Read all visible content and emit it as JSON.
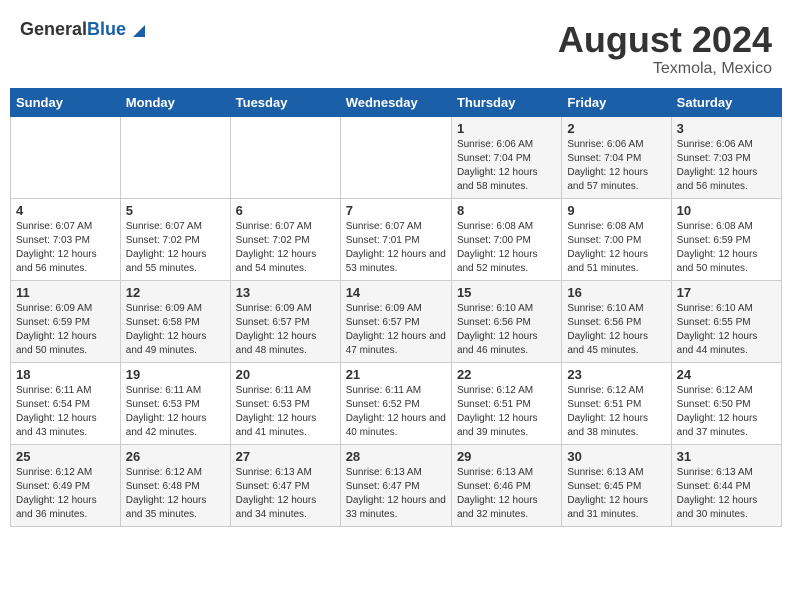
{
  "header": {
    "logo_general": "General",
    "logo_blue": "Blue",
    "month_year": "August 2024",
    "location": "Texmola, Mexico"
  },
  "weekdays": [
    "Sunday",
    "Monday",
    "Tuesday",
    "Wednesday",
    "Thursday",
    "Friday",
    "Saturday"
  ],
  "weeks": [
    [
      {
        "day": "",
        "sunrise": "",
        "sunset": "",
        "daylight": ""
      },
      {
        "day": "",
        "sunrise": "",
        "sunset": "",
        "daylight": ""
      },
      {
        "day": "",
        "sunrise": "",
        "sunset": "",
        "daylight": ""
      },
      {
        "day": "",
        "sunrise": "",
        "sunset": "",
        "daylight": ""
      },
      {
        "day": "1",
        "sunrise": "Sunrise: 6:06 AM",
        "sunset": "Sunset: 7:04 PM",
        "daylight": "Daylight: 12 hours and 58 minutes."
      },
      {
        "day": "2",
        "sunrise": "Sunrise: 6:06 AM",
        "sunset": "Sunset: 7:04 PM",
        "daylight": "Daylight: 12 hours and 57 minutes."
      },
      {
        "day": "3",
        "sunrise": "Sunrise: 6:06 AM",
        "sunset": "Sunset: 7:03 PM",
        "daylight": "Daylight: 12 hours and 56 minutes."
      }
    ],
    [
      {
        "day": "4",
        "sunrise": "Sunrise: 6:07 AM",
        "sunset": "Sunset: 7:03 PM",
        "daylight": "Daylight: 12 hours and 56 minutes."
      },
      {
        "day": "5",
        "sunrise": "Sunrise: 6:07 AM",
        "sunset": "Sunset: 7:02 PM",
        "daylight": "Daylight: 12 hours and 55 minutes."
      },
      {
        "day": "6",
        "sunrise": "Sunrise: 6:07 AM",
        "sunset": "Sunset: 7:02 PM",
        "daylight": "Daylight: 12 hours and 54 minutes."
      },
      {
        "day": "7",
        "sunrise": "Sunrise: 6:07 AM",
        "sunset": "Sunset: 7:01 PM",
        "daylight": "Daylight: 12 hours and 53 minutes."
      },
      {
        "day": "8",
        "sunrise": "Sunrise: 6:08 AM",
        "sunset": "Sunset: 7:00 PM",
        "daylight": "Daylight: 12 hours and 52 minutes."
      },
      {
        "day": "9",
        "sunrise": "Sunrise: 6:08 AM",
        "sunset": "Sunset: 7:00 PM",
        "daylight": "Daylight: 12 hours and 51 minutes."
      },
      {
        "day": "10",
        "sunrise": "Sunrise: 6:08 AM",
        "sunset": "Sunset: 6:59 PM",
        "daylight": "Daylight: 12 hours and 50 minutes."
      }
    ],
    [
      {
        "day": "11",
        "sunrise": "Sunrise: 6:09 AM",
        "sunset": "Sunset: 6:59 PM",
        "daylight": "Daylight: 12 hours and 50 minutes."
      },
      {
        "day": "12",
        "sunrise": "Sunrise: 6:09 AM",
        "sunset": "Sunset: 6:58 PM",
        "daylight": "Daylight: 12 hours and 49 minutes."
      },
      {
        "day": "13",
        "sunrise": "Sunrise: 6:09 AM",
        "sunset": "Sunset: 6:57 PM",
        "daylight": "Daylight: 12 hours and 48 minutes."
      },
      {
        "day": "14",
        "sunrise": "Sunrise: 6:09 AM",
        "sunset": "Sunset: 6:57 PM",
        "daylight": "Daylight: 12 hours and 47 minutes."
      },
      {
        "day": "15",
        "sunrise": "Sunrise: 6:10 AM",
        "sunset": "Sunset: 6:56 PM",
        "daylight": "Daylight: 12 hours and 46 minutes."
      },
      {
        "day": "16",
        "sunrise": "Sunrise: 6:10 AM",
        "sunset": "Sunset: 6:56 PM",
        "daylight": "Daylight: 12 hours and 45 minutes."
      },
      {
        "day": "17",
        "sunrise": "Sunrise: 6:10 AM",
        "sunset": "Sunset: 6:55 PM",
        "daylight": "Daylight: 12 hours and 44 minutes."
      }
    ],
    [
      {
        "day": "18",
        "sunrise": "Sunrise: 6:11 AM",
        "sunset": "Sunset: 6:54 PM",
        "daylight": "Daylight: 12 hours and 43 minutes."
      },
      {
        "day": "19",
        "sunrise": "Sunrise: 6:11 AM",
        "sunset": "Sunset: 6:53 PM",
        "daylight": "Daylight: 12 hours and 42 minutes."
      },
      {
        "day": "20",
        "sunrise": "Sunrise: 6:11 AM",
        "sunset": "Sunset: 6:53 PM",
        "daylight": "Daylight: 12 hours and 41 minutes."
      },
      {
        "day": "21",
        "sunrise": "Sunrise: 6:11 AM",
        "sunset": "Sunset: 6:52 PM",
        "daylight": "Daylight: 12 hours and 40 minutes."
      },
      {
        "day": "22",
        "sunrise": "Sunrise: 6:12 AM",
        "sunset": "Sunset: 6:51 PM",
        "daylight": "Daylight: 12 hours and 39 minutes."
      },
      {
        "day": "23",
        "sunrise": "Sunrise: 6:12 AM",
        "sunset": "Sunset: 6:51 PM",
        "daylight": "Daylight: 12 hours and 38 minutes."
      },
      {
        "day": "24",
        "sunrise": "Sunrise: 6:12 AM",
        "sunset": "Sunset: 6:50 PM",
        "daylight": "Daylight: 12 hours and 37 minutes."
      }
    ],
    [
      {
        "day": "25",
        "sunrise": "Sunrise: 6:12 AM",
        "sunset": "Sunset: 6:49 PM",
        "daylight": "Daylight: 12 hours and 36 minutes."
      },
      {
        "day": "26",
        "sunrise": "Sunrise: 6:12 AM",
        "sunset": "Sunset: 6:48 PM",
        "daylight": "Daylight: 12 hours and 35 minutes."
      },
      {
        "day": "27",
        "sunrise": "Sunrise: 6:13 AM",
        "sunset": "Sunset: 6:47 PM",
        "daylight": "Daylight: 12 hours and 34 minutes."
      },
      {
        "day": "28",
        "sunrise": "Sunrise: 6:13 AM",
        "sunset": "Sunset: 6:47 PM",
        "daylight": "Daylight: 12 hours and 33 minutes."
      },
      {
        "day": "29",
        "sunrise": "Sunrise: 6:13 AM",
        "sunset": "Sunset: 6:46 PM",
        "daylight": "Daylight: 12 hours and 32 minutes."
      },
      {
        "day": "30",
        "sunrise": "Sunrise: 6:13 AM",
        "sunset": "Sunset: 6:45 PM",
        "daylight": "Daylight: 12 hours and 31 minutes."
      },
      {
        "day": "31",
        "sunrise": "Sunrise: 6:13 AM",
        "sunset": "Sunset: 6:44 PM",
        "daylight": "Daylight: 12 hours and 30 minutes."
      }
    ]
  ]
}
